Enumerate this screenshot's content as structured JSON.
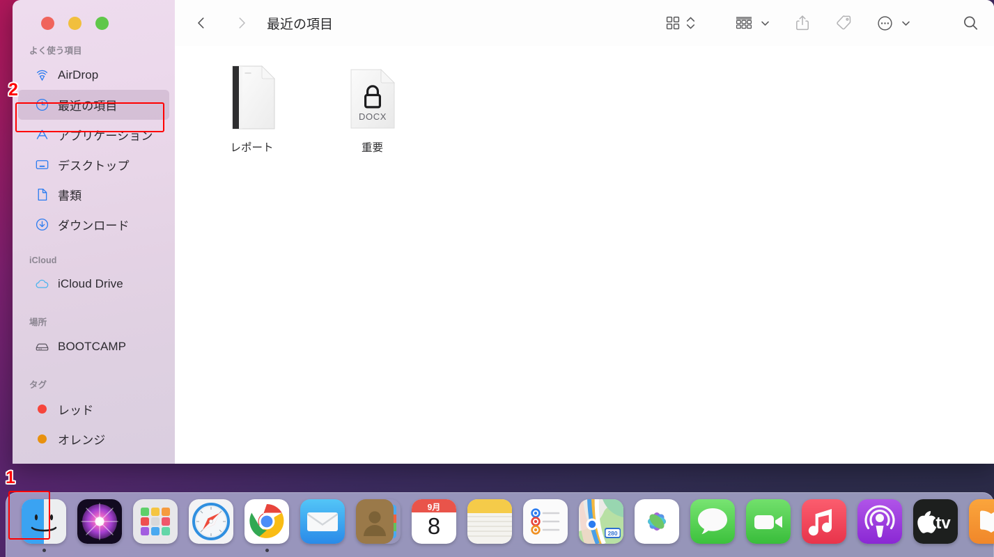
{
  "window": {
    "title": "最近の項目",
    "traffic_lights": [
      "close-button",
      "minimize-button",
      "maximize-button"
    ]
  },
  "toolbar": {
    "back_label": "‹",
    "forward_label": "›",
    "items": [
      {
        "name": "icon-view-button",
        "icon": "grid-view-icon"
      },
      {
        "name": "view-stepper",
        "icon": "chevron-up-down-icon"
      },
      {
        "name": "group-by-button",
        "icon": "group-list-icon"
      },
      {
        "name": "group-by-chevron",
        "icon": "chevron-down-icon"
      },
      {
        "name": "share-button",
        "icon": "share-icon"
      },
      {
        "name": "tag-button",
        "icon": "tag-icon"
      },
      {
        "name": "more-options-button",
        "icon": "ellipsis-circle-icon"
      },
      {
        "name": "more-options-chevron",
        "icon": "chevron-down-icon"
      },
      {
        "name": "search-button",
        "icon": "search-icon"
      }
    ]
  },
  "sidebar": {
    "sections": [
      {
        "title": "よく使う項目",
        "items": [
          {
            "label": "AirDrop",
            "icon": "airdrop-icon",
            "selected": false
          },
          {
            "label": "最近の項目",
            "icon": "clock-icon",
            "selected": true
          },
          {
            "label": "アプリケーション",
            "icon": "applications-icon",
            "selected": false
          },
          {
            "label": "デスクトップ",
            "icon": "desktop-icon",
            "selected": false
          },
          {
            "label": "書類",
            "icon": "document-icon",
            "selected": false
          },
          {
            "label": "ダウンロード",
            "icon": "download-icon",
            "selected": false
          }
        ]
      },
      {
        "title": "iCloud",
        "items": [
          {
            "label": "iCloud Drive",
            "icon": "cloud-icon",
            "selected": false
          }
        ]
      },
      {
        "title": "場所",
        "items": [
          {
            "label": "BOOTCAMP",
            "icon": "harddisk-icon",
            "selected": false
          }
        ]
      },
      {
        "title": "タグ",
        "items": [
          {
            "label": "レッド",
            "icon": "tag-dot-red",
            "color": "#f6453c",
            "selected": false
          },
          {
            "label": "オレンジ",
            "icon": "tag-dot-orange",
            "color": "#e8910e",
            "selected": false
          }
        ]
      }
    ]
  },
  "files": [
    {
      "name": "レポート",
      "icon": "plain-document-icon",
      "badge": ""
    },
    {
      "name": "重要",
      "icon": "locked-document-icon",
      "badge": "DOCX"
    }
  ],
  "dock": [
    {
      "label": "Finder",
      "icon": "finder-icon",
      "running": true
    },
    {
      "label": "Siri",
      "icon": "siri-icon",
      "running": false
    },
    {
      "label": "Launchpad",
      "icon": "launchpad-icon",
      "running": false
    },
    {
      "label": "Safari",
      "icon": "safari-icon",
      "running": false
    },
    {
      "label": "Chrome",
      "icon": "chrome-icon",
      "running": true
    },
    {
      "label": "Mail",
      "icon": "mail-icon",
      "running": false
    },
    {
      "label": "Contacts",
      "icon": "contacts-icon",
      "running": false
    },
    {
      "label": "Calendar",
      "icon": "calendar-icon",
      "running": false,
      "month": "9月",
      "day": "8"
    },
    {
      "label": "Notes",
      "icon": "notes-icon",
      "running": false
    },
    {
      "label": "Reminders",
      "icon": "reminders-icon",
      "running": false
    },
    {
      "label": "Maps",
      "icon": "maps-icon",
      "running": false,
      "route": "280"
    },
    {
      "label": "Photos",
      "icon": "photos-icon",
      "running": false
    },
    {
      "label": "Messages",
      "icon": "messages-icon",
      "running": false
    },
    {
      "label": "FaceTime",
      "icon": "facetime-icon",
      "running": false
    },
    {
      "label": "Music",
      "icon": "music-icon",
      "running": false
    },
    {
      "label": "Podcasts",
      "icon": "podcasts-icon",
      "running": false
    },
    {
      "label": "Apple TV",
      "icon": "appletv-icon",
      "running": false,
      "text": "tv"
    },
    {
      "label": "Books",
      "icon": "books-icon",
      "running": false
    }
  ],
  "annotations": [
    {
      "number": "1",
      "target": "dock-finder-icon"
    },
    {
      "number": "2",
      "target": "sidebar-item-recents"
    }
  ],
  "colors": {
    "annotation": "#ff0000",
    "sidebar_icon": "#2b7cf0",
    "selected_row": "rgba(110,80,120,.17)"
  }
}
